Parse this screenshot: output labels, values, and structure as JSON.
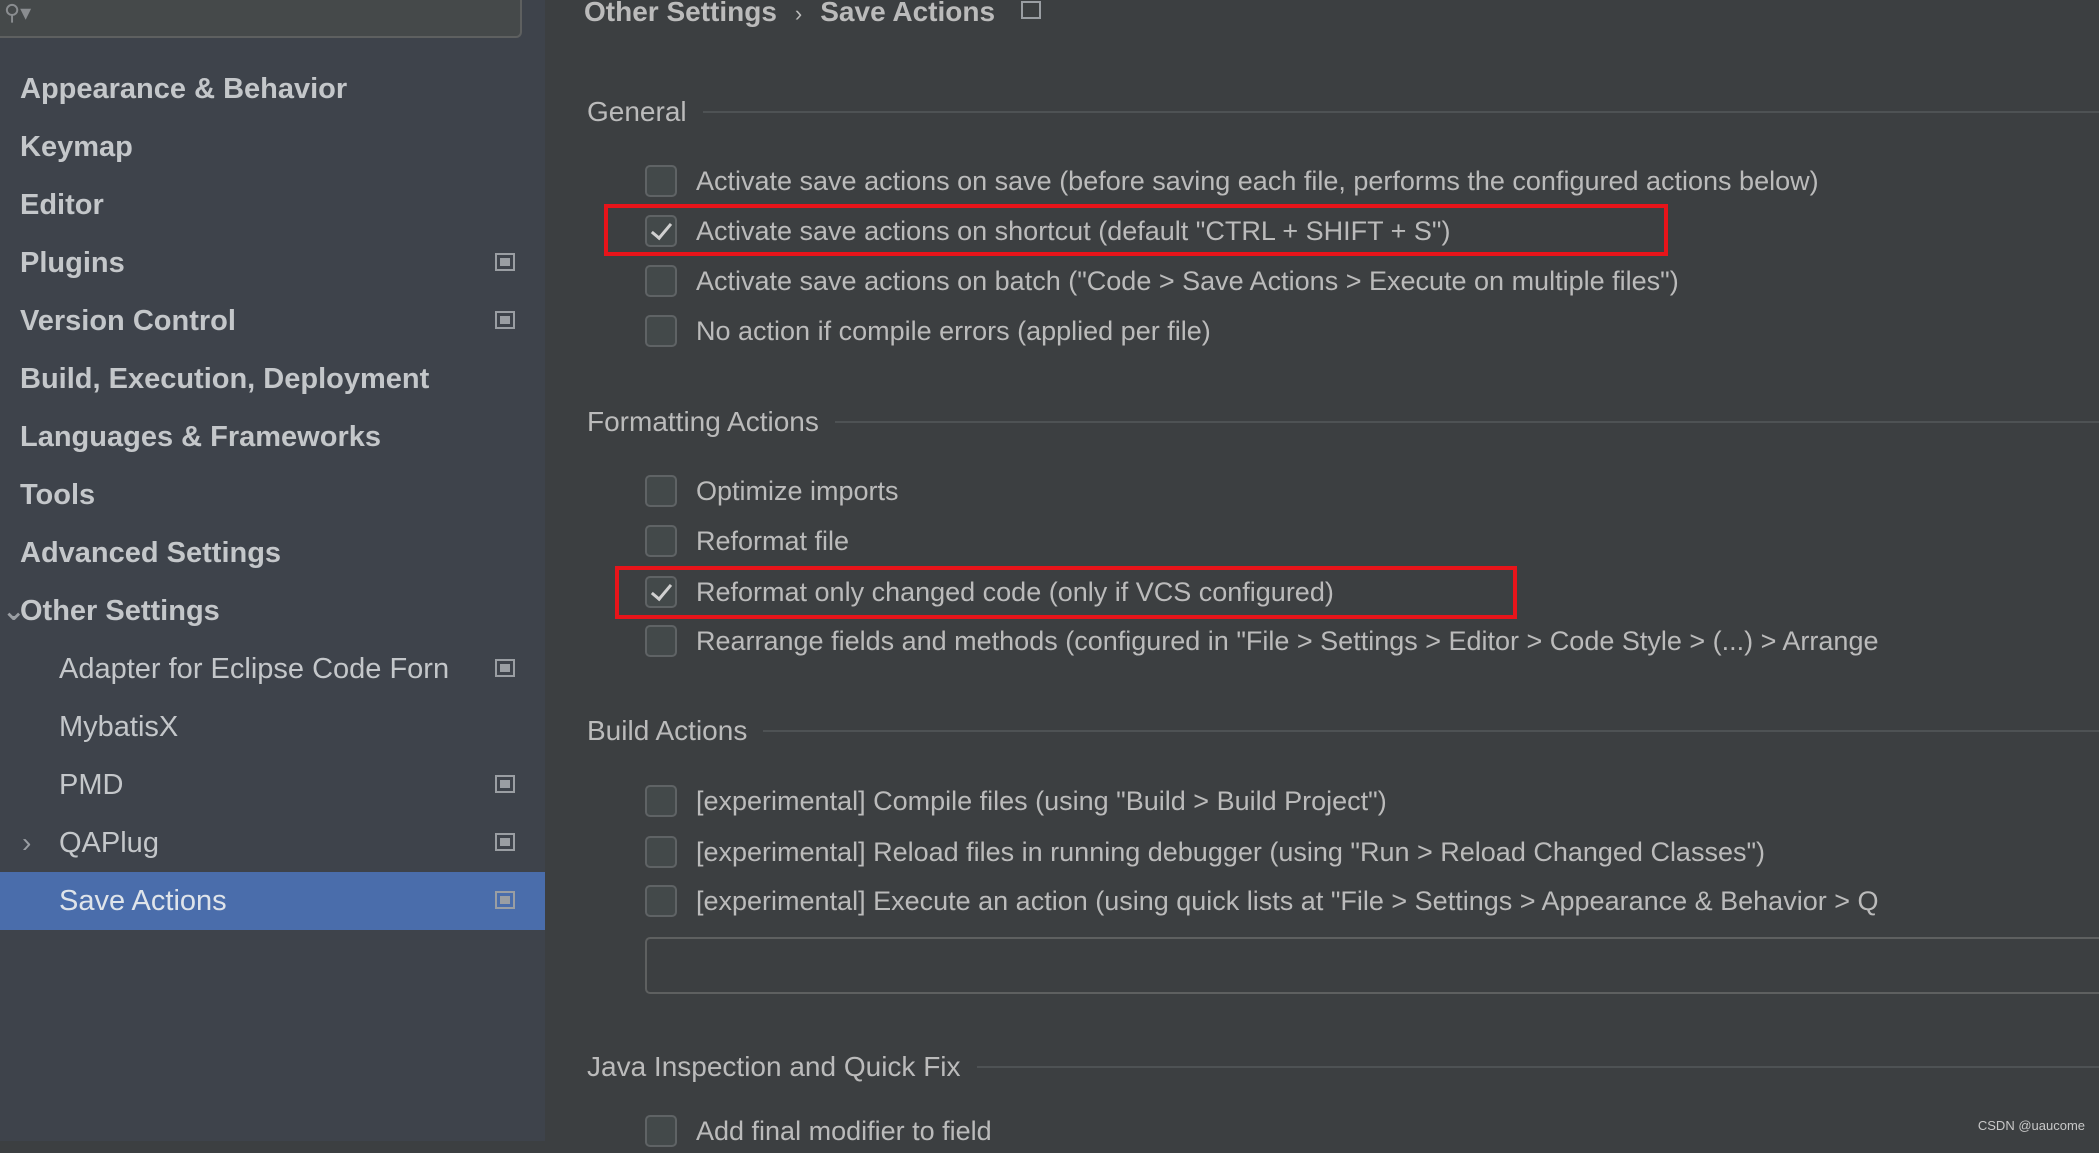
{
  "search": {
    "icon": "search-icon"
  },
  "sidebar": {
    "items": [
      {
        "label": "Appearance & Behavior",
        "level": "top"
      },
      {
        "label": "Keymap",
        "level": "top"
      },
      {
        "label": "Editor",
        "level": "top"
      },
      {
        "label": "Plugins",
        "level": "top",
        "project_icon": true
      },
      {
        "label": "Version Control",
        "level": "top",
        "project_icon": true
      },
      {
        "label": "Build, Execution, Deployment",
        "level": "top"
      },
      {
        "label": "Languages & Frameworks",
        "level": "top"
      },
      {
        "label": "Tools",
        "level": "top"
      },
      {
        "label": "Advanced Settings",
        "level": "top"
      },
      {
        "label": "Other Settings",
        "level": "top",
        "expanded": true
      },
      {
        "label": "Adapter for Eclipse Code Forn",
        "level": "child",
        "project_icon": true
      },
      {
        "label": "MybatisX",
        "level": "child"
      },
      {
        "label": "PMD",
        "level": "child",
        "project_icon": true
      },
      {
        "label": "QAPlug",
        "level": "child",
        "project_icon": true,
        "collapsed": true
      },
      {
        "label": "Save Actions",
        "level": "child",
        "project_icon": true,
        "selected": true
      }
    ]
  },
  "breadcrumb": {
    "parent": "Other Settings",
    "separator": "›",
    "current": "Save Actions"
  },
  "sections": {
    "general": {
      "title": "General",
      "options": [
        {
          "label": "Activate save actions on save (before saving each file, performs the configured actions below)",
          "checked": false
        },
        {
          "label": "Activate save actions on shortcut (default \"CTRL + SHIFT + S\")",
          "checked": true,
          "highlighted": true
        },
        {
          "label": "Activate save actions on batch (\"Code > Save Actions > Execute on multiple files\")",
          "checked": false
        },
        {
          "label": "No action if compile errors (applied per file)",
          "checked": false
        }
      ]
    },
    "formatting": {
      "title": "Formatting Actions",
      "options": [
        {
          "label": "Optimize imports",
          "checked": false
        },
        {
          "label": "Reformat file",
          "checked": false
        },
        {
          "label": "Reformat only changed code (only if VCS configured)",
          "checked": true,
          "highlighted": true
        },
        {
          "label": "Rearrange fields and methods (configured in \"File > Settings > Editor > Code Style > (...) > Arrange",
          "checked": false
        }
      ]
    },
    "build": {
      "title": "Build Actions",
      "options": [
        {
          "label": "[experimental] Compile files (using \"Build > Build Project\")",
          "checked": false
        },
        {
          "label": "[experimental] Reload files in running debugger (using \"Run > Reload Changed Classes\")",
          "checked": false
        },
        {
          "label": "[experimental] Execute an action (using quick lists at \"File > Settings > Appearance & Behavior > Q",
          "checked": false
        }
      ],
      "field_value": ""
    },
    "java": {
      "title": "Java Inspection and Quick Fix",
      "options": [
        {
          "label": "Add final modifier to field",
          "checked": false
        }
      ]
    }
  },
  "watermark": "CSDN @uaucome",
  "colors": {
    "highlight_box": "#e8141a",
    "selection": "#4a6dab",
    "background": "#3c3f41",
    "sidebar": "#3e434b"
  }
}
